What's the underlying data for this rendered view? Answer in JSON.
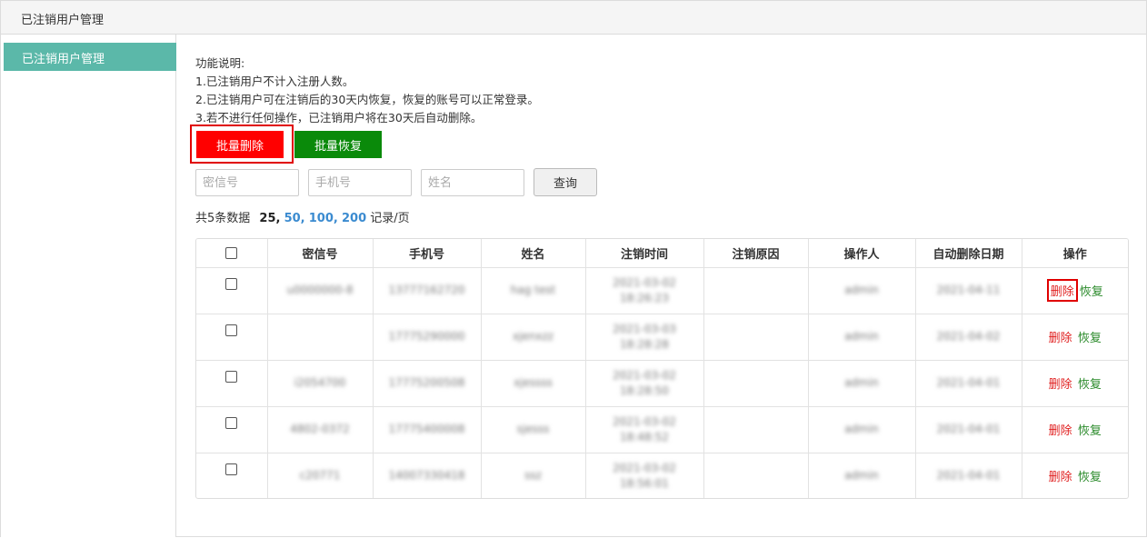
{
  "header": {
    "title": "已注销用户管理"
  },
  "sidebar": {
    "items": [
      {
        "label": "已注销用户管理"
      }
    ]
  },
  "description": {
    "heading": "功能说明:",
    "lines": [
      "1.已注销用户不计入注册人数。",
      "2.已注销用户可在注销后的30天内恢复，恢复的账号可以正常登录。",
      "3.若不进行任何操作，已注销用户将在30天后自动删除。"
    ]
  },
  "buttons": {
    "batch_delete": "批量删除",
    "batch_restore": "批量恢复",
    "query": "查询"
  },
  "search": {
    "mixin_placeholder": "密信号",
    "phone_placeholder": "手机号",
    "name_placeholder": "姓名"
  },
  "pager": {
    "total": "共5条数据",
    "current": "25,",
    "opt1": "50,",
    "opt2": "100,",
    "opt3": "200",
    "suffix": "记录/页"
  },
  "table": {
    "headers": [
      "密信号",
      "手机号",
      "姓名",
      "注销时间",
      "注销原因",
      "操作人",
      "自动删除日期",
      "操作"
    ],
    "rows": [
      {
        "mixin": "u0000000-8",
        "phone": "13777162720",
        "name": "hag test",
        "time1": "2021-03-02",
        "time2": "18:26:23",
        "reason": "",
        "operator": "admin",
        "date": "2021-04-11",
        "del": "删除",
        "rec": "恢复"
      },
      {
        "mixin": "",
        "phone": "17775290000",
        "name": "xjenxzz",
        "time1": "2021-03-03",
        "time2": "18:28:28",
        "reason": "",
        "operator": "admin",
        "date": "2021-04-02",
        "del": "删除",
        "rec": "恢复"
      },
      {
        "mixin": "i2054700",
        "phone": "17775200508",
        "name": "xjessss",
        "time1": "2021-03-02",
        "time2": "18:28:50",
        "reason": "",
        "operator": "admin",
        "date": "2021-04-01",
        "del": "删除",
        "rec": "恢复"
      },
      {
        "mixin": "4802-0372",
        "phone": "17775400008",
        "name": "sjesss",
        "time1": "2021-03-02",
        "time2": "18:48:52",
        "reason": "",
        "operator": "admin",
        "date": "2021-04-01",
        "del": "删除",
        "rec": "恢复"
      },
      {
        "mixin": "c20771",
        "phone": "14007330418",
        "name": "ssz",
        "time1": "2021-03-02",
        "time2": "18:56:01",
        "reason": "",
        "operator": "admin",
        "date": "2021-04-01",
        "del": "删除",
        "rec": "恢复"
      }
    ]
  },
  "colors": {
    "accent": "#5bb8a9",
    "danger": "#ff0000",
    "success": "#0a8a0a",
    "link": "#3b8bd0"
  }
}
